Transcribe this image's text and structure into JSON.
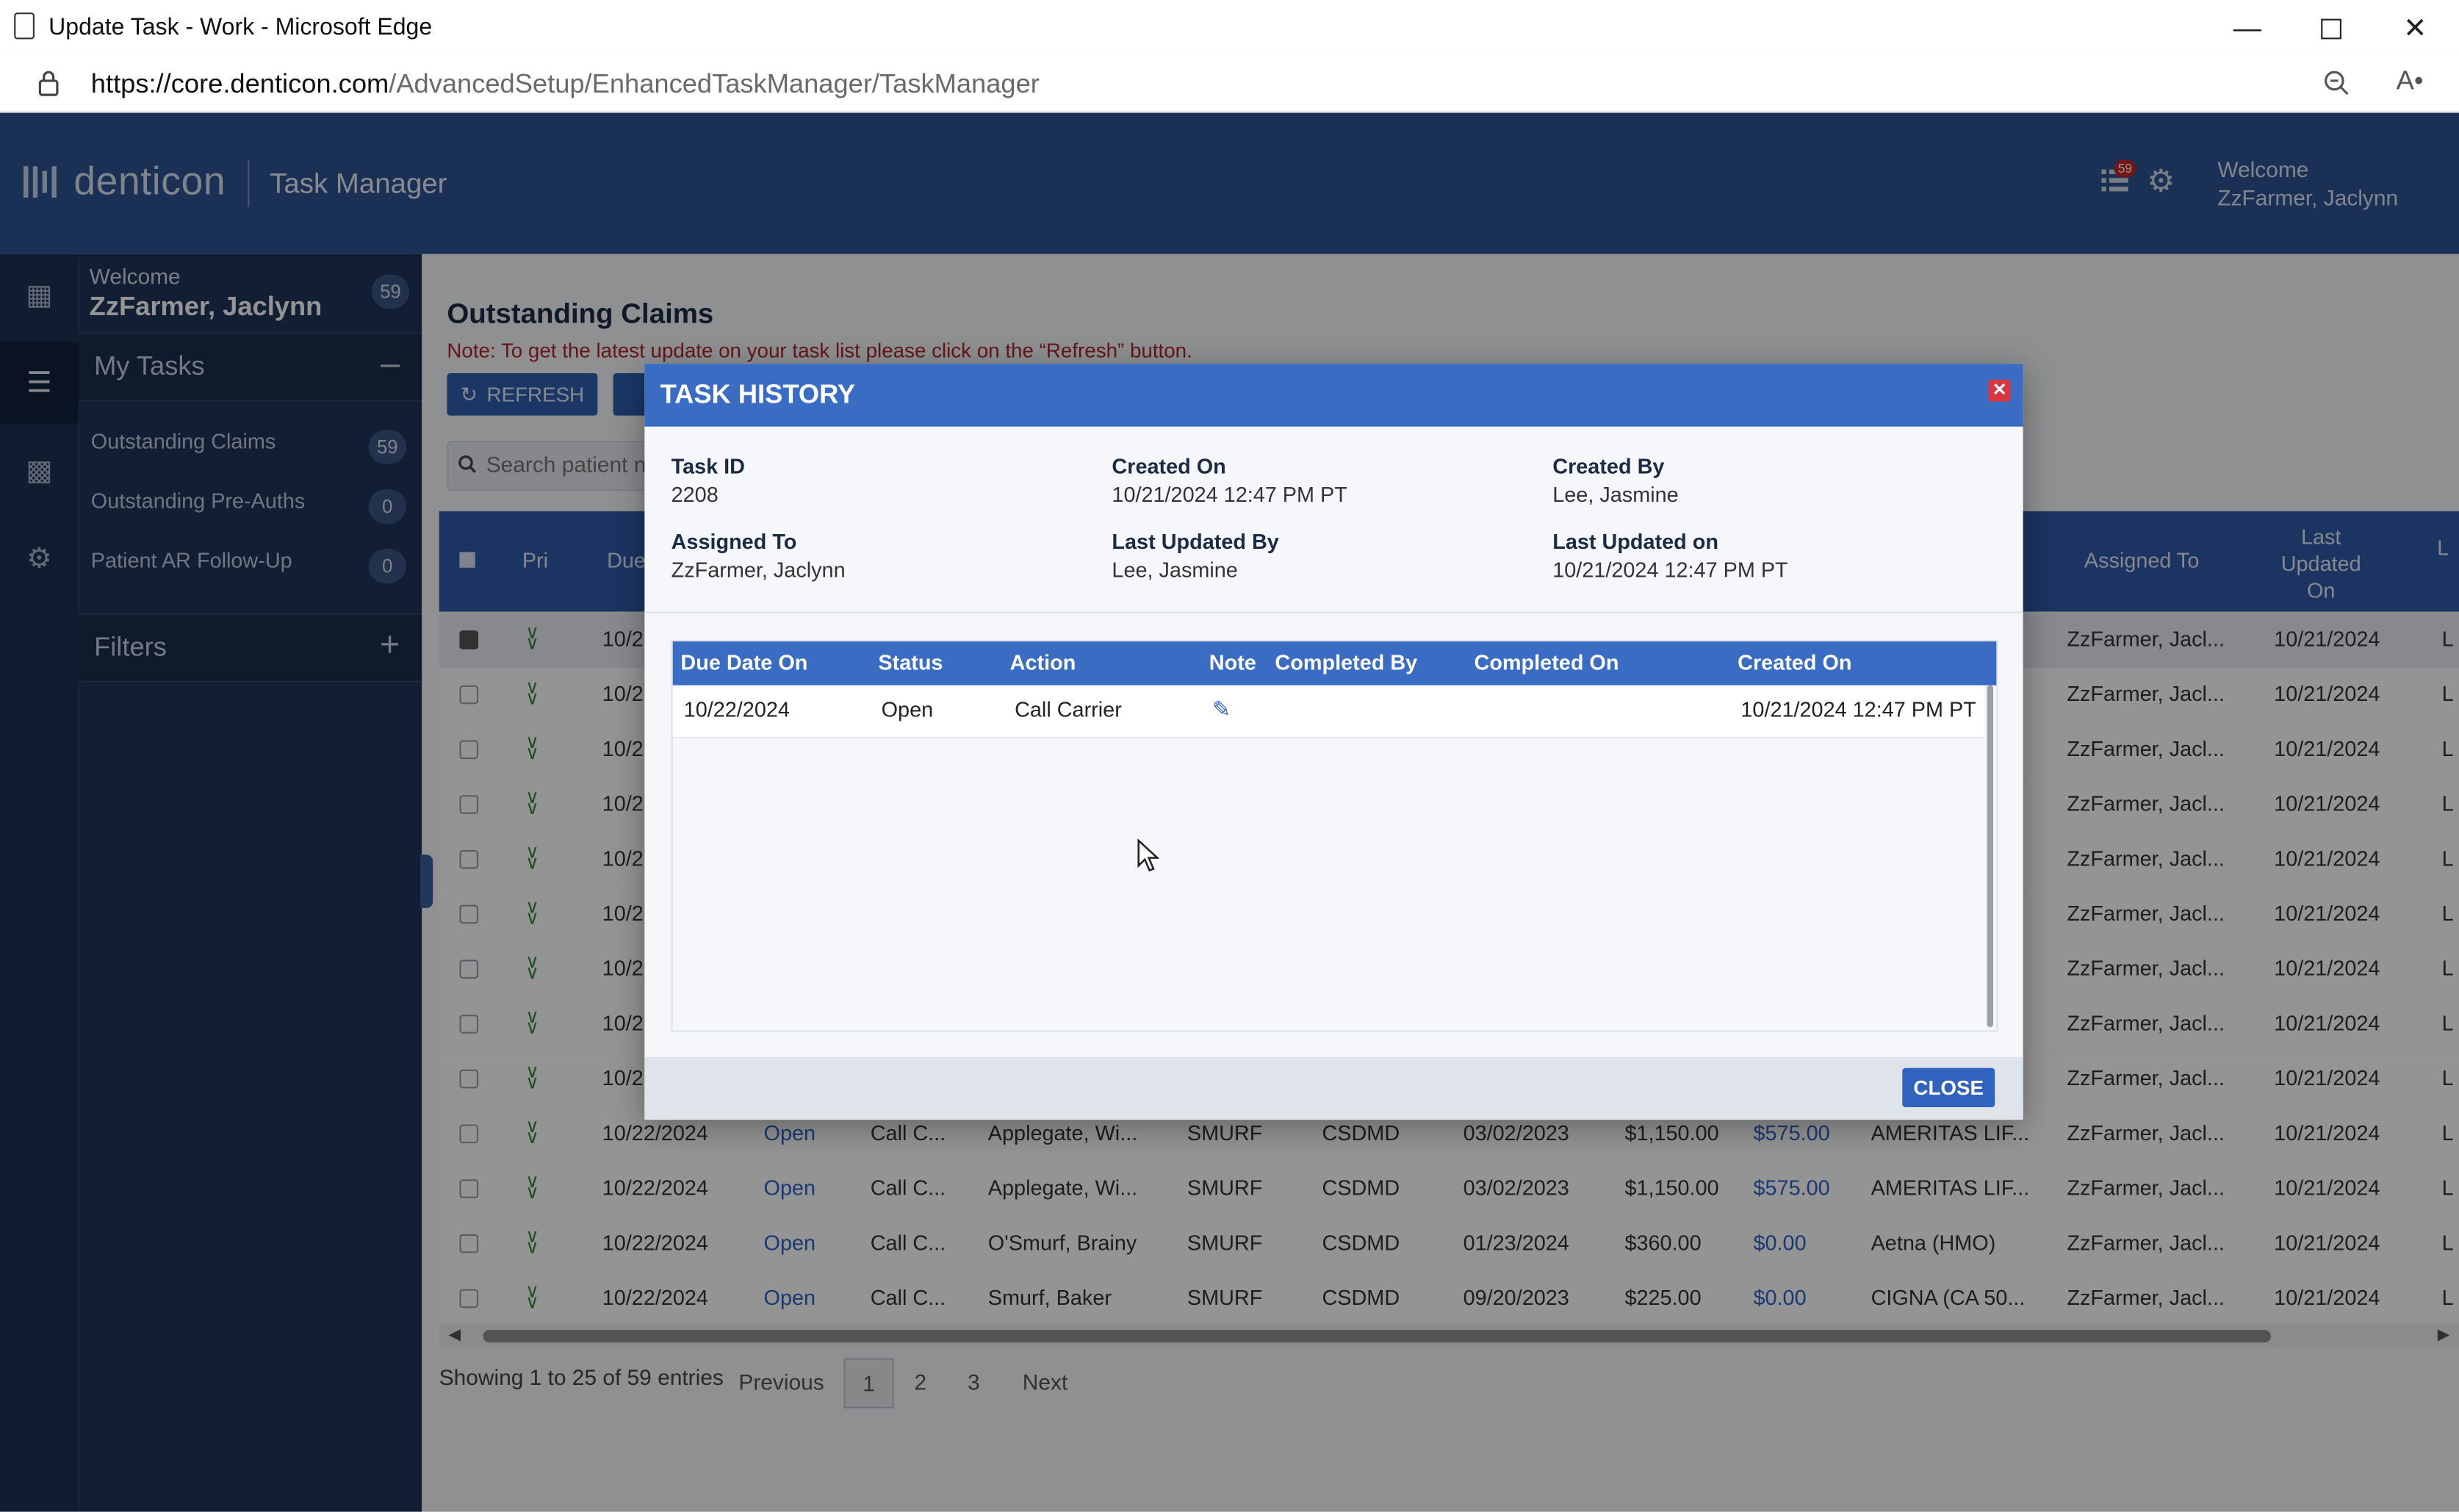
{
  "browser": {
    "window_title": "Update Task - Work - Microsoft Edge",
    "url_host": "https://core.denticon.com",
    "url_path": "/AdvancedSetup/EnhancedTaskManager/TaskManager"
  },
  "header": {
    "brand": "denticon",
    "module": "Task Manager",
    "notification_count": "59",
    "welcome_label": "Welcome",
    "user_name": "ZzFarmer, Jaclynn"
  },
  "sidebar": {
    "welcome_label": "Welcome",
    "user_name": "ZzFarmer, Jaclynn",
    "user_count": "59",
    "my_tasks_label": "My Tasks",
    "items": [
      {
        "label": "Outstanding Claims",
        "count": "59"
      },
      {
        "label": "Outstanding Pre-Auths",
        "count": "0"
      },
      {
        "label": "Patient AR Follow-Up",
        "count": "0"
      }
    ],
    "filters_label": "Filters"
  },
  "main": {
    "title": "Outstanding Claims",
    "note": "Note: To get the latest update on your task list please click on the “Refresh” button.",
    "refresh_label": "REFRESH",
    "search_placeholder": "Search patient n",
    "columns": {
      "pri": "Pri",
      "due": "Due",
      "assigned_to": "Assigned To",
      "last_updated_on": "Last Updated On",
      "more": "L"
    },
    "rows": [
      {
        "due": "10/2",
        "assigned": "ZzFarmer, Jacl...",
        "updated": "10/21/2024",
        "more": "L"
      },
      {
        "due": "10/2",
        "assigned": "ZzFarmer, Jacl...",
        "updated": "10/21/2024",
        "more": "L"
      },
      {
        "due": "10/2",
        "assigned": "ZzFarmer, Jacl...",
        "updated": "10/21/2024",
        "more": "L"
      },
      {
        "due": "10/2",
        "assigned": "ZzFarmer, Jacl...",
        "updated": "10/21/2024",
        "more": "L"
      },
      {
        "due": "10/2",
        "assigned": "ZzFarmer, Jacl...",
        "updated": "10/21/2024",
        "more": "L"
      },
      {
        "due": "10/2",
        "assigned": "ZzFarmer, Jacl...",
        "updated": "10/21/2024",
        "more": "L"
      },
      {
        "due": "10/2",
        "assigned": "ZzFarmer, Jacl...",
        "updated": "10/21/2024",
        "more": "L"
      },
      {
        "due": "10/2",
        "assigned": "ZzFarmer, Jacl...",
        "updated": "10/21/2024",
        "more": "L"
      },
      {
        "due": "10/2",
        "assigned": "ZzFarmer, Jacl...",
        "updated": "10/21/2024",
        "more": "L"
      }
    ],
    "full_rows": [
      {
        "due": "10/22/2024",
        "status": "Open",
        "action": "Call C...",
        "patient": "Applegate, Wi...",
        "provider": "SMURF",
        "office": "CSDMD",
        "dos": "03/02/2023",
        "billed": "$1,150.00",
        "balance": "$575.00",
        "carrier": "AMERITAS LIF...",
        "assigned": "ZzFarmer, Jacl...",
        "updated": "10/21/2024",
        "more": "L"
      },
      {
        "due": "10/22/2024",
        "status": "Open",
        "action": "Call C...",
        "patient": "Applegate, Wi...",
        "provider": "SMURF",
        "office": "CSDMD",
        "dos": "03/02/2023",
        "billed": "$1,150.00",
        "balance": "$575.00",
        "carrier": "AMERITAS LIF...",
        "assigned": "ZzFarmer, Jacl...",
        "updated": "10/21/2024",
        "more": "L"
      },
      {
        "due": "10/22/2024",
        "status": "Open",
        "action": "Call C...",
        "patient": "O'Smurf, Brainy",
        "provider": "SMURF",
        "office": "CSDMD",
        "dos": "01/23/2024",
        "billed": "$360.00",
        "balance": "$0.00",
        "carrier": "Aetna (HMO)",
        "assigned": "ZzFarmer, Jacl...",
        "updated": "10/21/2024",
        "more": "L"
      },
      {
        "due": "10/22/2024",
        "status": "Open",
        "action": "Call C...",
        "patient": "Smurf, Baker",
        "provider": "SMURF",
        "office": "CSDMD",
        "dos": "09/20/2023",
        "billed": "$225.00",
        "balance": "$0.00",
        "carrier": "CIGNA (CA 50...",
        "assigned": "ZzFarmer, Jacl...",
        "updated": "10/21/2024",
        "more": "L"
      }
    ],
    "pager": {
      "summary": "Showing 1 to 25 of 59 entries",
      "previous": "Previous",
      "pages": [
        "1",
        "2",
        "3"
      ],
      "next": "Next"
    }
  },
  "modal": {
    "title": "TASK HISTORY",
    "task_id_label": "Task ID",
    "task_id": "2208",
    "created_on_label": "Created On",
    "created_on": "10/21/2024 12:47 PM PT",
    "created_by_label": "Created By",
    "created_by": "Lee, Jasmine",
    "assigned_to_label": "Assigned To",
    "assigned_to": "ZzFarmer, Jaclynn",
    "last_updated_by_label": "Last Updated By",
    "last_updated_by": "Lee, Jasmine",
    "last_updated_on_label": "Last Updated on",
    "last_updated_on": "10/21/2024 12:47 PM PT",
    "history_columns": {
      "due_date_on": "Due Date On",
      "status": "Status",
      "action": "Action",
      "note": "Note",
      "completed_by": "Completed By",
      "completed_on": "Completed On",
      "created_on": "Created On"
    },
    "history_rows": [
      {
        "due_date_on": "10/22/2024",
        "status": "Open",
        "action": "Call Carrier",
        "completed_by": "",
        "completed_on": "",
        "created_on": "10/21/2024 12:47 PM PT"
      }
    ],
    "close_label": "CLOSE"
  },
  "colors": {
    "header_blue": "#2e5392",
    "modal_blue": "#3a6cc4",
    "sidebar_navy": "#20355a",
    "rail_navy": "#1d3154",
    "alert_red": "#b0252b",
    "link_blue": "#2d62c4"
  }
}
